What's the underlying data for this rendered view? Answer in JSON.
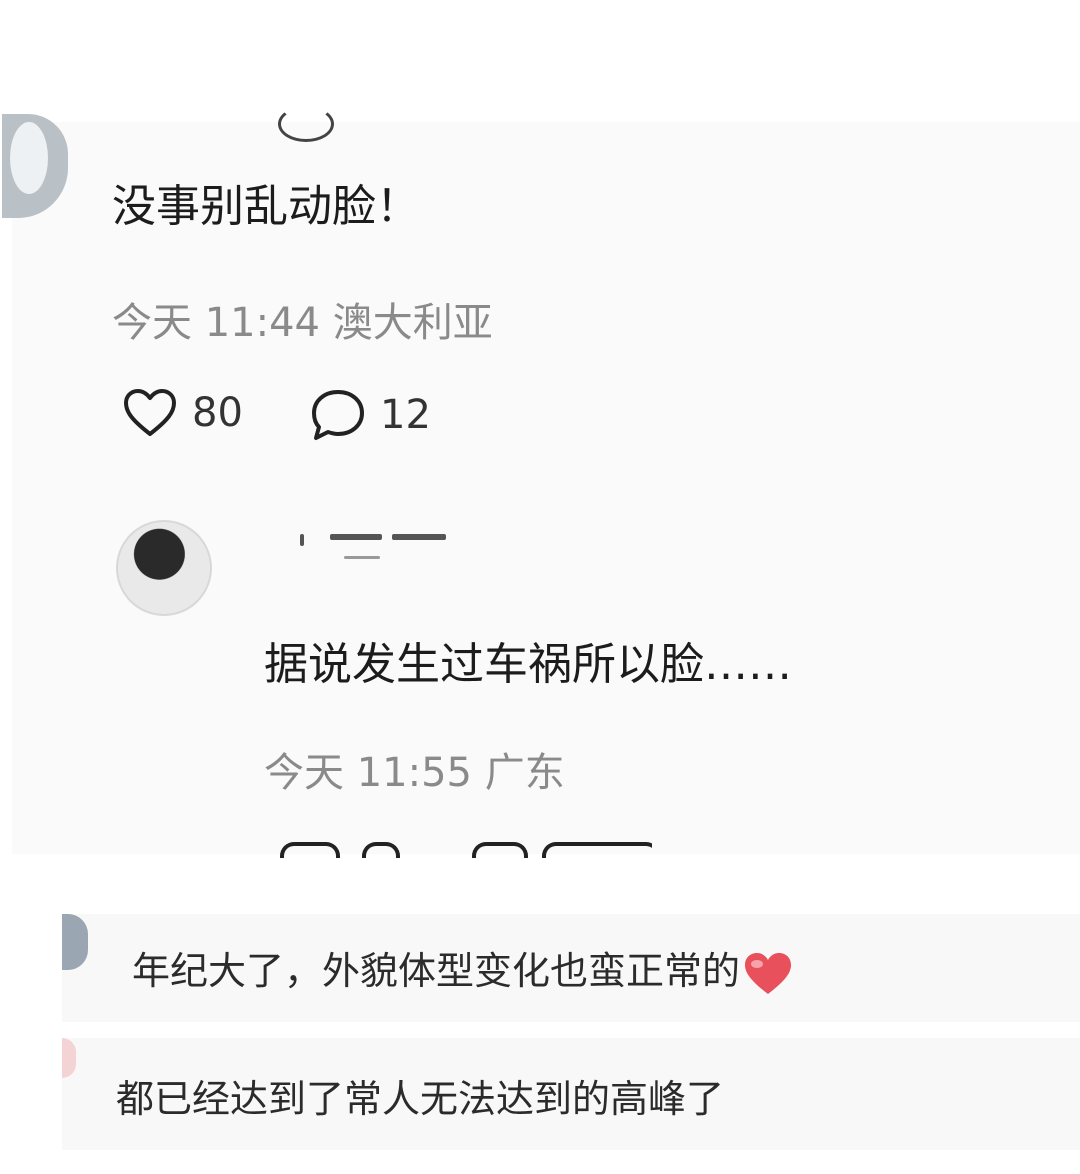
{
  "comment1": {
    "text": "没事别乱动脸！",
    "time": "今天 11:44",
    "location": "澳大利亚",
    "likes": "80",
    "replies": "12"
  },
  "reply1": {
    "text": "据说发生过车祸所以脸……",
    "time": "今天 11:55",
    "location": "广东"
  },
  "comment2": {
    "text": "年纪大了，外貌体型变化也蛮正常的"
  },
  "comment3": {
    "text": "都已经达到了常人无法达到的高峰了"
  },
  "colors": {
    "text": "#1c1c1c",
    "meta": "#8a8a8a",
    "heart": "#e8505b"
  }
}
